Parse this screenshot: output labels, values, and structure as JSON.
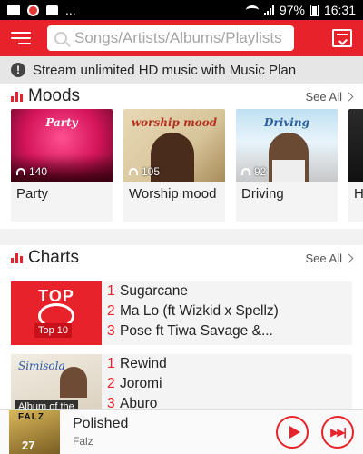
{
  "status_bar": {
    "battery": "97%",
    "time": "16:31",
    "dots": "..."
  },
  "search": {
    "placeholder": "Songs/Artists/Albums/Playlists"
  },
  "banner": {
    "text": "Stream unlimited HD music with Music Plan"
  },
  "moods": {
    "title": "Moods",
    "see_all": "See All",
    "items": [
      {
        "name": "Party",
        "count": "140",
        "art_title": "Party"
      },
      {
        "name": "Worship mood",
        "count": "105",
        "art_title": "worship mood"
      },
      {
        "name": "Driving",
        "count": "92",
        "art_title": "Driving"
      },
      {
        "name": "H"
      }
    ]
  },
  "charts": {
    "title": "Charts",
    "see_all": "See All",
    "groups": [
      {
        "label": "Top 10",
        "art_title": "TOP",
        "tracks": [
          {
            "rank": "1",
            "title": "Sugarcane"
          },
          {
            "rank": "2",
            "title": "Ma Lo (ft Wizkid x Spellz)"
          },
          {
            "rank": "3",
            "title": "Pose ft Tiwa Savage &..."
          }
        ]
      },
      {
        "label": "Album of the",
        "art_title": "Simisola",
        "tracks": [
          {
            "rank": "1",
            "title": "Rewind"
          },
          {
            "rank": "2",
            "title": "Joromi"
          },
          {
            "rank": "3",
            "title": "Aburo"
          }
        ]
      }
    ]
  },
  "player": {
    "title": "Polished",
    "artist": "Falz",
    "art_text": "FALZ",
    "art_num": "27"
  },
  "colors": {
    "accent": "#e8222a",
    "banner_bg": "#e6e6e6"
  }
}
